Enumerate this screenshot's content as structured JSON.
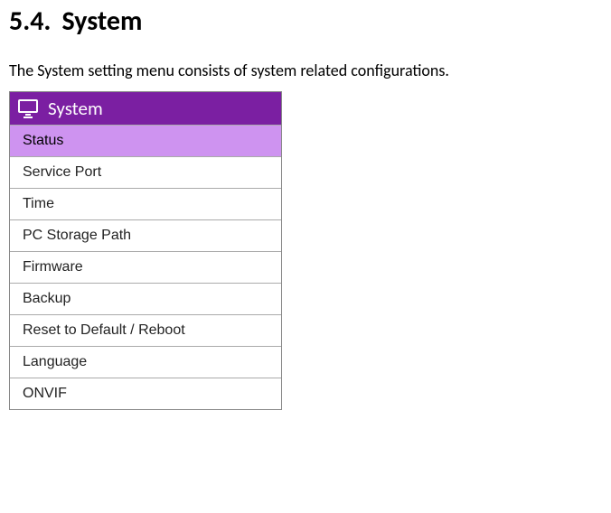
{
  "heading": {
    "number": "5.4.",
    "title": "System"
  },
  "intro": "The System setting menu consists of system related configurations.",
  "menu": {
    "title": "System",
    "items": [
      {
        "label": "Status",
        "active": true
      },
      {
        "label": "Service Port",
        "active": false
      },
      {
        "label": "Time",
        "active": false
      },
      {
        "label": "PC Storage Path",
        "active": false
      },
      {
        "label": "Firmware",
        "active": false
      },
      {
        "label": "Backup",
        "active": false
      },
      {
        "label": "Reset to Default / Reboot",
        "active": false
      },
      {
        "label": "Language",
        "active": false
      },
      {
        "label": "ONVIF",
        "active": false
      }
    ]
  }
}
